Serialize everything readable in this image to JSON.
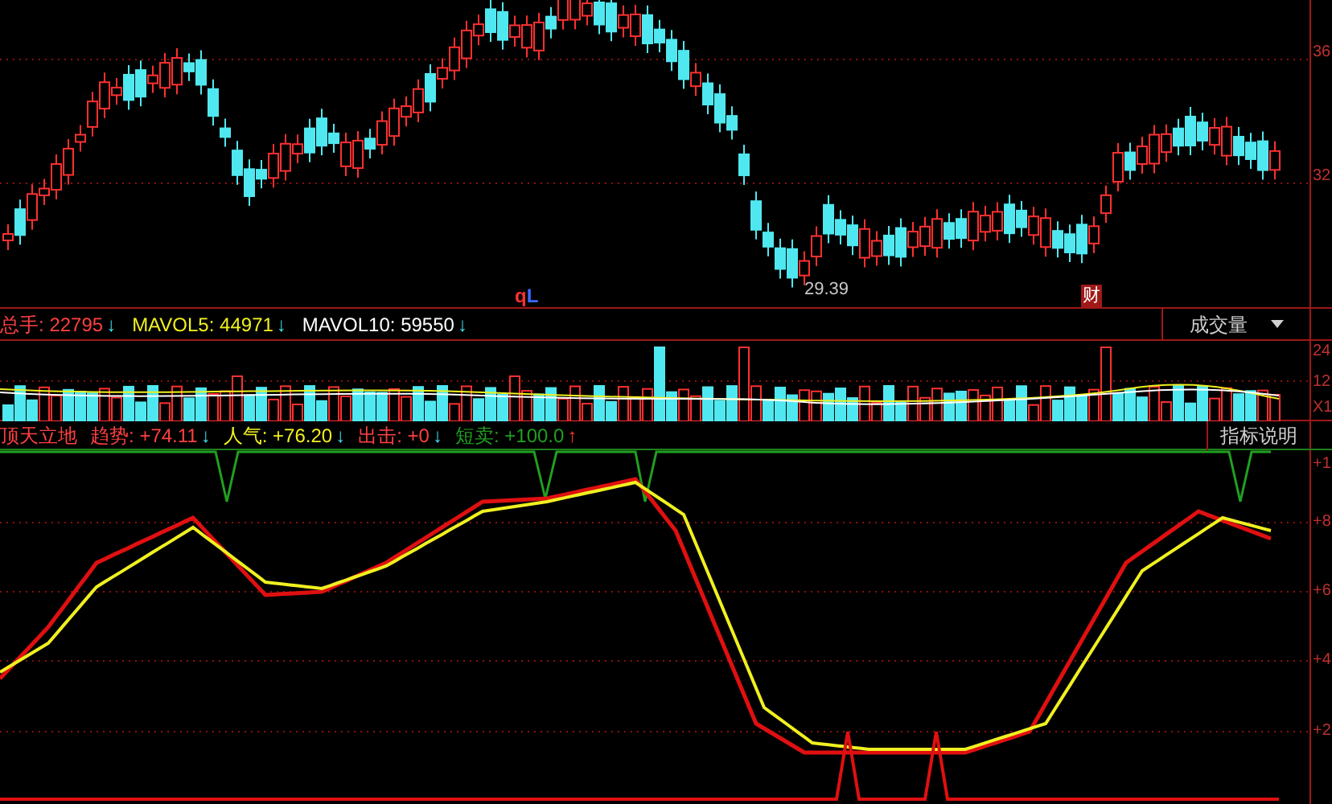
{
  "price_chart": {
    "axis_labels": [
      "36",
      "32"
    ],
    "low_marker": "29.39",
    "event_marks": [
      {
        "text": "q",
        "color": "#ff3030"
      },
      {
        "text": "L",
        "color": "#3a6bff"
      }
    ],
    "finance_badge": "财"
  },
  "volume_panel": {
    "legend": [
      {
        "label": "总手:",
        "value": "22795",
        "arrow": "↓"
      },
      {
        "label": "MAVOL5:",
        "value": "44971",
        "arrow": "↓"
      },
      {
        "label": "MAVOL10:",
        "value": "59550",
        "arrow": "↓"
      }
    ],
    "selector": "成交量",
    "axis_labels": [
      "24",
      "12",
      "X1"
    ]
  },
  "indicator_panel": {
    "name": "顶天立地",
    "legend": [
      {
        "label": "趋势:",
        "value": "+74.11",
        "arrow": "↓"
      },
      {
        "label": "人气:",
        "value": "+76.20",
        "arrow": "↓"
      },
      {
        "label": "出击:",
        "value": "+0",
        "arrow": "↓"
      },
      {
        "label": "短卖:",
        "value": "+100.0",
        "arrow": "↑"
      }
    ],
    "help_button": "指标说明",
    "axis_labels": [
      "+1",
      "+8",
      "+6",
      "+4",
      "+2"
    ]
  }
}
